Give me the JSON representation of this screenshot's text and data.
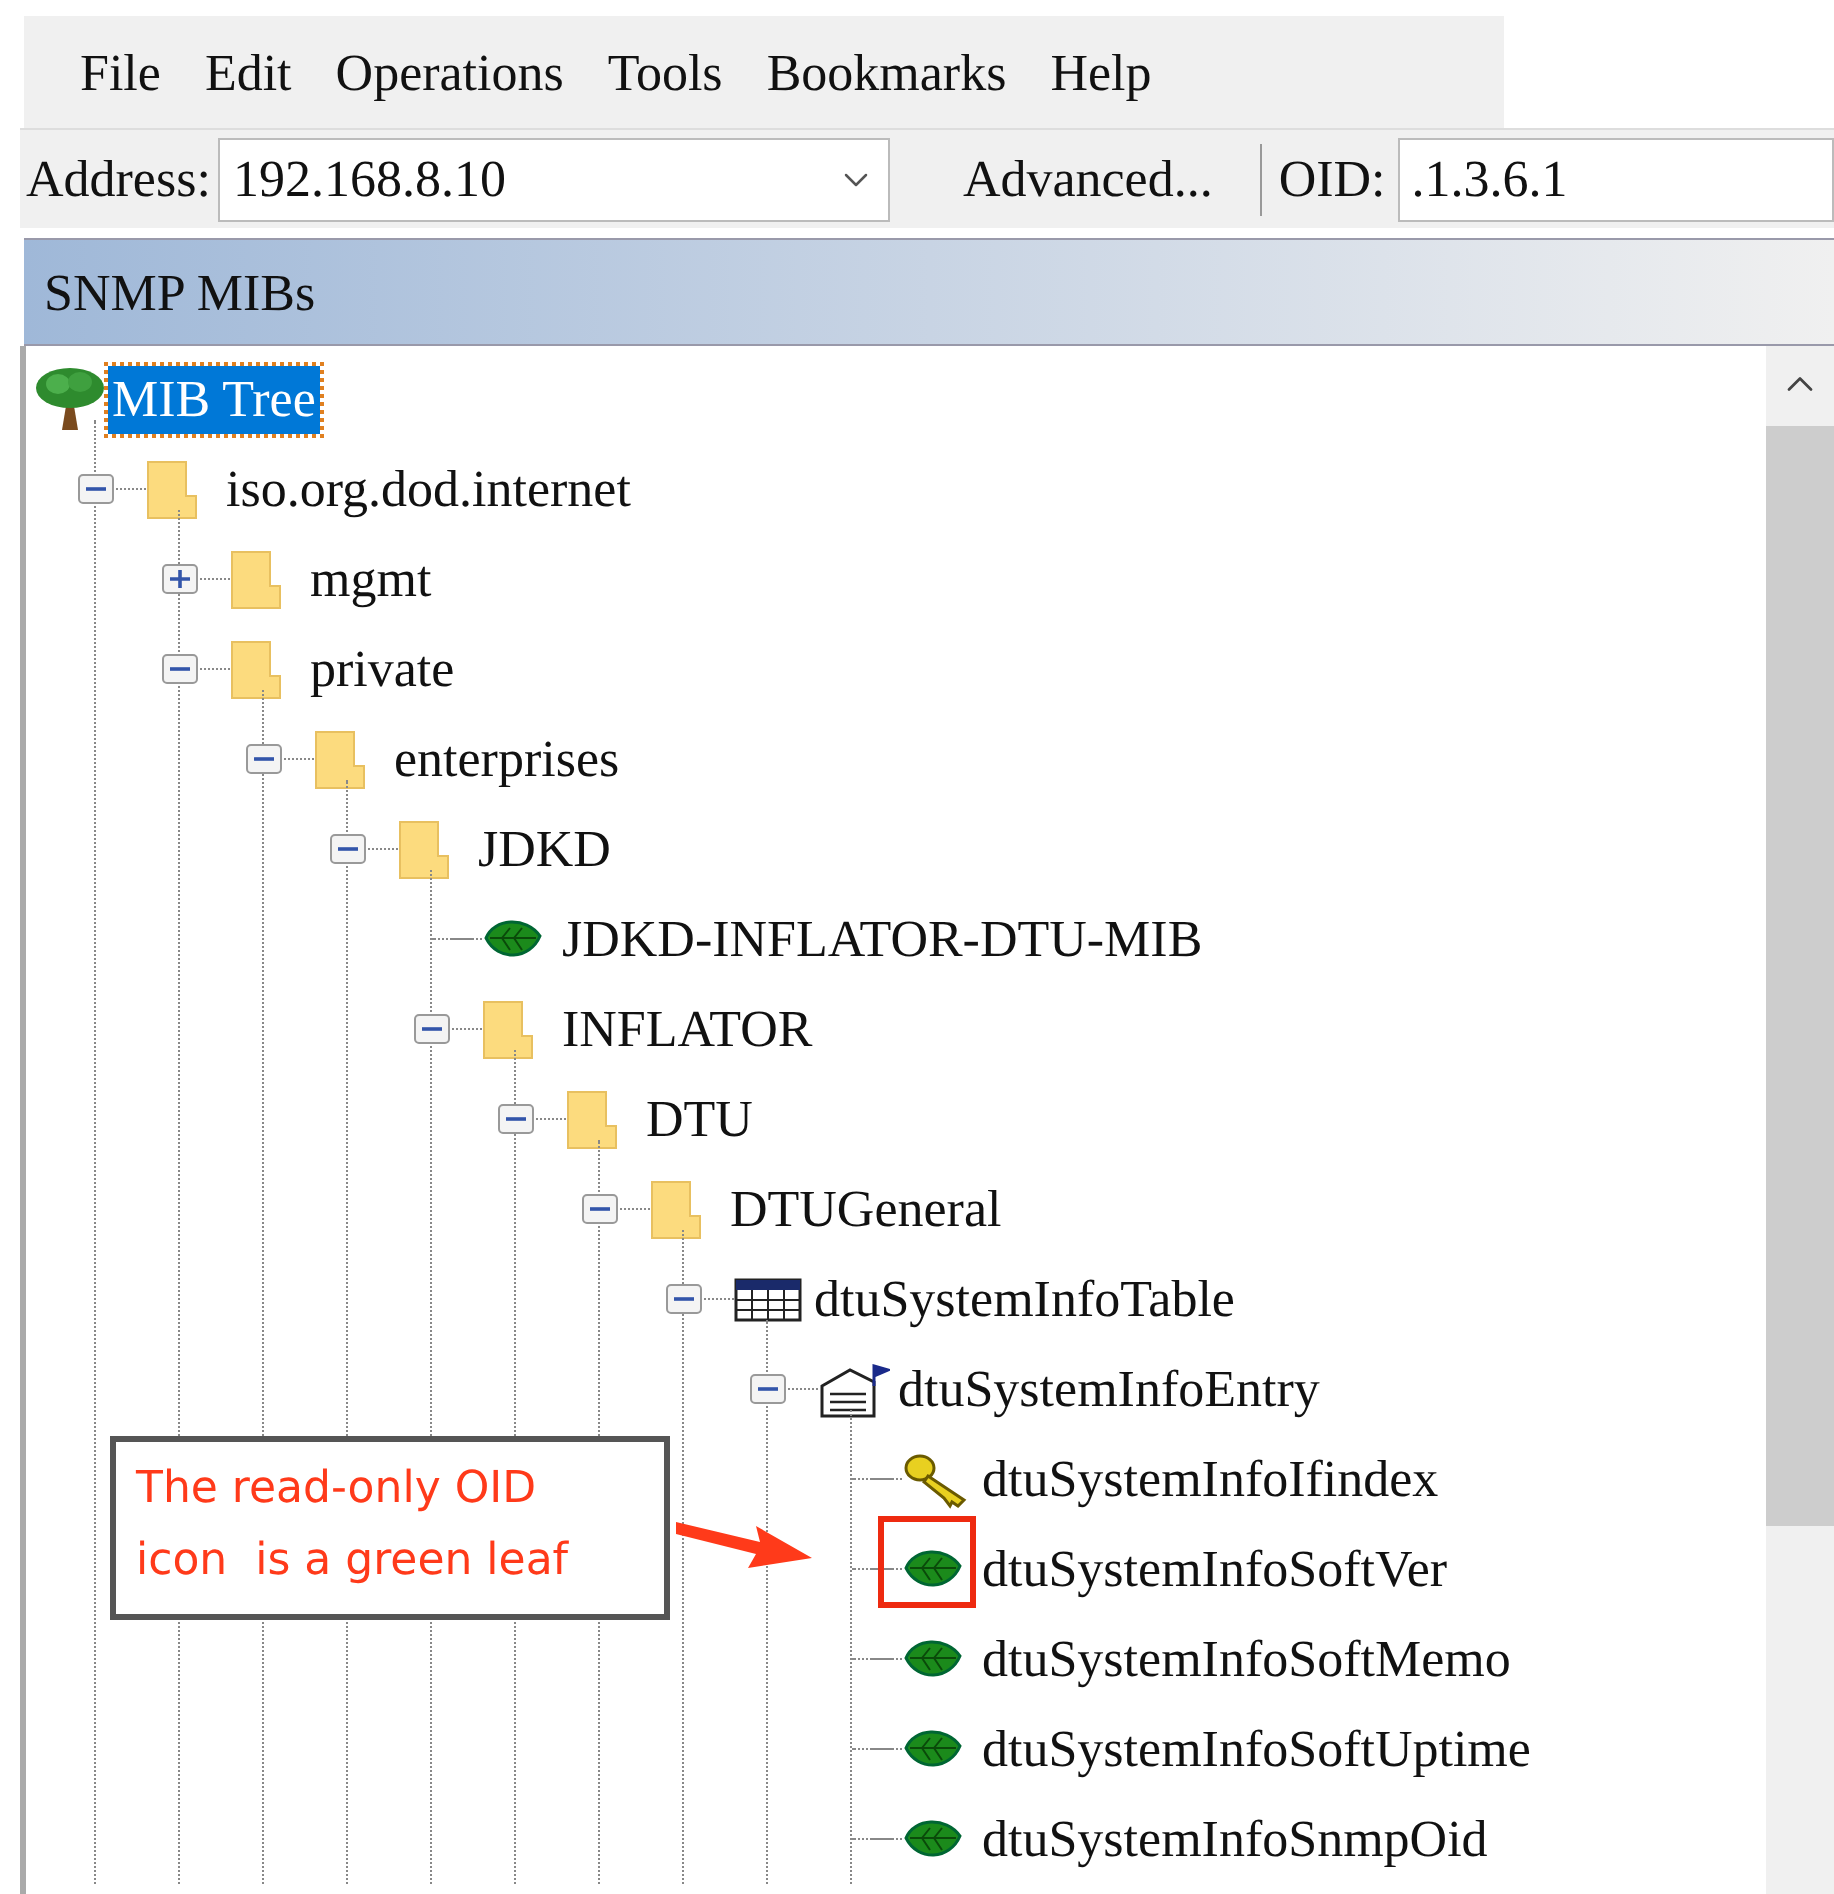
{
  "menu": [
    "File",
    "Edit",
    "Operations",
    "Tools",
    "Bookmarks",
    "Help"
  ],
  "toolbar": {
    "address_label": "Address:",
    "address_value": "192.168.8.10",
    "advanced_button": "Advanced...",
    "oid_label": "OID:",
    "oid_value": ".1.3.6.1"
  },
  "panel": {
    "title": "SNMP MIBs"
  },
  "tree": [
    {
      "label": "MIB Tree",
      "kind": "root",
      "selected": true,
      "children": [
        {
          "label": "iso.org.dod.internet",
          "kind": "folder",
          "selected": false,
          "expanded": true,
          "children": [
            {
              "label": "mgmt",
              "kind": "folder",
              "selected": false,
              "expanded": false
            },
            {
              "label": "private",
              "kind": "folder",
              "selected": false,
              "expanded": true,
              "children": [
                {
                  "label": "enterprises",
                  "kind": "folder",
                  "selected": false,
                  "expanded": true,
                  "children": [
                    {
                      "label": "JDKD",
                      "kind": "folder",
                      "selected": false,
                      "expanded": true,
                      "children": [
                        {
                          "label": "JDKD-INFLATOR-DTU-MIB",
                          "kind": "leaf",
                          "selected": false
                        },
                        {
                          "label": "INFLATOR",
                          "kind": "folder",
                          "selected": false,
                          "expanded": true,
                          "children": [
                            {
                              "label": "DTU",
                              "kind": "folder",
                              "selected": false,
                              "expanded": true,
                              "children": [
                                {
                                  "label": "DTUGeneral",
                                  "kind": "folder",
                                  "selected": false,
                                  "expanded": true,
                                  "children": [
                                    {
                                      "label": "dtuSystemInfoTable",
                                      "kind": "table",
                                      "selected": false,
                                      "expanded": true,
                                      "children": [
                                        {
                                          "label": "dtuSystemInfoEntry",
                                          "kind": "entry",
                                          "selected": false,
                                          "expanded": true,
                                          "children": [
                                            {
                                              "label": "dtuSystemInfoIfindex",
                                              "kind": "key",
                                              "selected": false
                                            },
                                            {
                                              "label": "dtuSystemInfoSoftVer",
                                              "kind": "leaf",
                                              "selected": false,
                                              "highlighted": true
                                            },
                                            {
                                              "label": "dtuSystemInfoSoftMemo",
                                              "kind": "leaf",
                                              "selected": false
                                            },
                                            {
                                              "label": "dtuSystemInfoSoftUptime",
                                              "kind": "leaf",
                                              "selected": false
                                            },
                                            {
                                              "label": "dtuSystemInfoSnmpOid",
                                              "kind": "leaf",
                                              "selected": false
                                            }
                                          ]
                                        }
                                      ]
                                    }
                                  ]
                                }
                              ]
                            }
                          ]
                        }
                      ]
                    }
                  ]
                }
              ]
            }
          ]
        }
      ]
    }
  ],
  "callout": {
    "lines": [
      "The read-only OID",
      "icon  is a green leaf"
    ]
  }
}
